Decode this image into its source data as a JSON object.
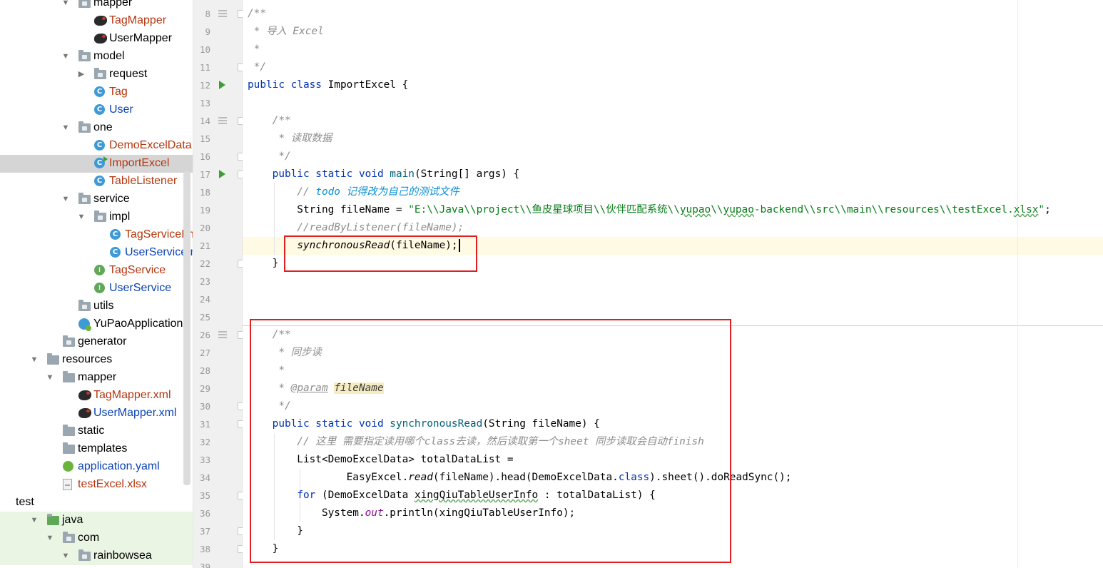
{
  "tree": {
    "items": [
      {
        "label": "mapper",
        "color": "black",
        "icon": "folder-icon",
        "arrow": "expanded",
        "indent": 1
      },
      {
        "label": "TagMapper",
        "color": "orange",
        "icon": "mybatis-mapper-icon",
        "arrow": "",
        "indent": 2
      },
      {
        "label": "UserMapper",
        "color": "black",
        "icon": "mybatis-mapper-icon",
        "arrow": "",
        "indent": 2
      },
      {
        "label": "model",
        "color": "black",
        "icon": "folder-icon",
        "arrow": "expanded",
        "indent": 1
      },
      {
        "label": "request",
        "color": "black",
        "icon": "folder-icon",
        "arrow": "collapsed",
        "indent": 2
      },
      {
        "label": "Tag",
        "color": "orange",
        "icon": "class-icon",
        "arrow": "",
        "indent": 2
      },
      {
        "label": "User",
        "color": "blue",
        "icon": "class-icon",
        "arrow": "",
        "indent": 2
      },
      {
        "label": "one",
        "color": "black",
        "icon": "folder-icon",
        "arrow": "expanded",
        "indent": 1
      },
      {
        "label": "DemoExcelData",
        "color": "orange",
        "icon": "class-icon",
        "arrow": "",
        "indent": 2
      },
      {
        "label": "ImportExcel",
        "color": "orange",
        "icon": "runnable-class-icon",
        "arrow": "",
        "indent": 2,
        "selected": true
      },
      {
        "label": "TableListener",
        "color": "orange",
        "icon": "class-icon",
        "arrow": "",
        "indent": 2
      },
      {
        "label": "service",
        "color": "black",
        "icon": "folder-icon",
        "arrow": "expanded",
        "indent": 1
      },
      {
        "label": "impl",
        "color": "black",
        "icon": "folder-icon",
        "arrow": "expanded",
        "indent": 2
      },
      {
        "label": "TagServiceImpl",
        "color": "orange",
        "icon": "class-icon",
        "arrow": "",
        "indent": 3
      },
      {
        "label": "UserServiceImpl",
        "color": "blue",
        "icon": "class-icon",
        "arrow": "",
        "indent": 3
      },
      {
        "label": "TagService",
        "color": "orange",
        "icon": "interface-icon",
        "arrow": "",
        "indent": 2
      },
      {
        "label": "UserService",
        "color": "blue",
        "icon": "interface-icon",
        "arrow": "",
        "indent": 2
      },
      {
        "label": "utils",
        "color": "black",
        "icon": "folder-icon",
        "arrow": "",
        "indent": 1
      },
      {
        "label": "YuPaoApplication",
        "color": "black",
        "icon": "spring-boot-app-icon",
        "arrow": "",
        "indent": 1
      },
      {
        "label": "generator",
        "color": "black",
        "icon": "folder-icon",
        "arrow": "",
        "indent": 0
      },
      {
        "label": "resources",
        "color": "black",
        "icon": "resources-folder-icon",
        "arrow": "expanded",
        "indent": -1
      },
      {
        "label": "mapper",
        "color": "black",
        "icon": "plain-folder-icon",
        "arrow": "expanded",
        "indent": 0
      },
      {
        "label": "TagMapper.xml",
        "color": "orange",
        "icon": "mybatis-xml-icon",
        "arrow": "",
        "indent": 1
      },
      {
        "label": "UserMapper.xml",
        "color": "blue",
        "icon": "mybatis-xml-icon",
        "arrow": "",
        "indent": 1
      },
      {
        "label": "static",
        "color": "black",
        "icon": "plain-folder-icon",
        "arrow": "",
        "indent": 0
      },
      {
        "label": "templates",
        "color": "black",
        "icon": "plain-folder-icon",
        "arrow": "",
        "indent": 0
      },
      {
        "label": "application.yaml",
        "color": "blue",
        "icon": "yaml-config-icon",
        "arrow": "",
        "indent": 0
      },
      {
        "label": "testExcel.xlsx",
        "color": "orange",
        "icon": "excel-file-icon",
        "arrow": "",
        "indent": 0
      },
      {
        "label": "test",
        "color": "black",
        "icon": "",
        "arrow": "",
        "indent": -2
      },
      {
        "label": "java",
        "color": "black",
        "icon": "test-source-folder-icon",
        "arrow": "expanded",
        "indent": -1,
        "test": true
      },
      {
        "label": "com",
        "color": "black",
        "icon": "folder-icon",
        "arrow": "expanded",
        "indent": 0,
        "test": true
      },
      {
        "label": "rainbowsea",
        "color": "black",
        "icon": "folder-icon",
        "arrow": "expanded",
        "indent": 1,
        "test": true
      }
    ]
  },
  "gutter": {
    "line_numbers": [
      "8",
      "9",
      "10",
      "11",
      "12",
      "13",
      "14",
      "15",
      "16",
      "17",
      "18",
      "19",
      "20",
      "21",
      "22",
      "23",
      "24",
      "25",
      "26",
      "27",
      "28",
      "29",
      "30",
      "31",
      "32",
      "33",
      "34",
      "35",
      "36",
      "37",
      "38",
      "39"
    ]
  },
  "code": {
    "lines": [
      [
        {
          "t": "/**",
          "c": "cm"
        }
      ],
      [
        {
          "t": " * 导入 Excel",
          "c": "cm"
        }
      ],
      [
        {
          "t": " *",
          "c": "cm"
        }
      ],
      [
        {
          "t": " */",
          "c": "cm"
        }
      ],
      [
        {
          "t": "public class ",
          "c": "kw"
        },
        {
          "t": "ImportExcel {",
          "c": ""
        }
      ],
      [],
      [
        {
          "t": "    /**",
          "c": "cm"
        }
      ],
      [
        {
          "t": "     * 读取数据",
          "c": "cm"
        }
      ],
      [
        {
          "t": "     */",
          "c": "cm"
        }
      ],
      [
        {
          "t": "    public static void ",
          "c": "kw"
        },
        {
          "t": "main",
          "c": "fn"
        },
        {
          "t": "(String[] args) {",
          "c": ""
        }
      ],
      [
        {
          "t": "        // ",
          "c": "cm"
        },
        {
          "t": "todo 记得改为自己的测试文件",
          "c": "todo"
        }
      ],
      [
        {
          "t": "        String fileName = ",
          "c": ""
        },
        {
          "t": "\"E:\\\\Java\\\\project\\\\鱼皮星球项目\\\\伙伴匹配系统\\\\",
          "c": "str"
        },
        {
          "t": "yupao",
          "c": "str squiggle"
        },
        {
          "t": "\\\\",
          "c": "str"
        },
        {
          "t": "yupao",
          "c": "str squiggle"
        },
        {
          "t": "-backend\\\\src\\\\main\\\\resources\\\\testExcel.",
          "c": "str"
        },
        {
          "t": "xlsx",
          "c": "str squiggle"
        },
        {
          "t": "\"",
          "c": "str"
        },
        {
          "t": ";",
          "c": ""
        }
      ],
      [
        {
          "t": "        //readByListener(fileName);",
          "c": "cm"
        }
      ],
      [
        {
          "t": "        ",
          "c": ""
        },
        {
          "t": "synchronousRead",
          "c": "it"
        },
        {
          "t": "(fileName);",
          "c": ""
        },
        {
          "t": "",
          "c": "caret"
        }
      ],
      [
        {
          "t": "    }",
          "c": ""
        }
      ],
      [],
      [],
      [],
      [
        {
          "t": "    /**",
          "c": "cm"
        }
      ],
      [
        {
          "t": "     * 同步读",
          "c": "cm"
        }
      ],
      [
        {
          "t": "     *",
          "c": "cm"
        }
      ],
      [
        {
          "t": "     * ",
          "c": "cm"
        },
        {
          "t": "@param",
          "c": "doctag"
        },
        {
          "t": " ",
          "c": "cm"
        },
        {
          "t": "fileName",
          "c": "param"
        }
      ],
      [
        {
          "t": "     */",
          "c": "cm"
        }
      ],
      [
        {
          "t": "    public static void ",
          "c": "kw"
        },
        {
          "t": "synchronousRead",
          "c": "fn"
        },
        {
          "t": "(String fileName) {",
          "c": ""
        }
      ],
      [
        {
          "t": "        // 这里 需要指定读用哪个class去读，然后读取第一个sheet 同步读取会自动finish",
          "c": "cm"
        }
      ],
      [
        {
          "t": "        List<DemoExcelData> totalDataList =",
          "c": ""
        }
      ],
      [
        {
          "t": "                EasyExcel.",
          "c": ""
        },
        {
          "t": "read",
          "c": "it"
        },
        {
          "t": "(fileName).head(DemoExcelData.",
          "c": ""
        },
        {
          "t": "class",
          "c": "kw"
        },
        {
          "t": ").sheet().doReadSync();",
          "c": ""
        }
      ],
      [
        {
          "t": "        ",
          "c": ""
        },
        {
          "t": "for ",
          "c": "kw"
        },
        {
          "t": "(DemoExcelData ",
          "c": ""
        },
        {
          "t": "xingQiuTableUserInfo",
          "c": "squiggle"
        },
        {
          "t": " : totalDataList) {",
          "c": ""
        }
      ],
      [
        {
          "t": "            System.",
          "c": ""
        },
        {
          "t": "out",
          "c": "field"
        },
        {
          "t": ".println(xingQiuTableUserInfo);",
          "c": ""
        }
      ],
      [
        {
          "t": "        }",
          "c": ""
        }
      ],
      [
        {
          "t": "    }",
          "c": ""
        }
      ],
      []
    ]
  },
  "colors": {
    "annotation_box": "#e02020",
    "current_line": "#fffae3",
    "selected_tree_row": "#d5d5d5"
  }
}
